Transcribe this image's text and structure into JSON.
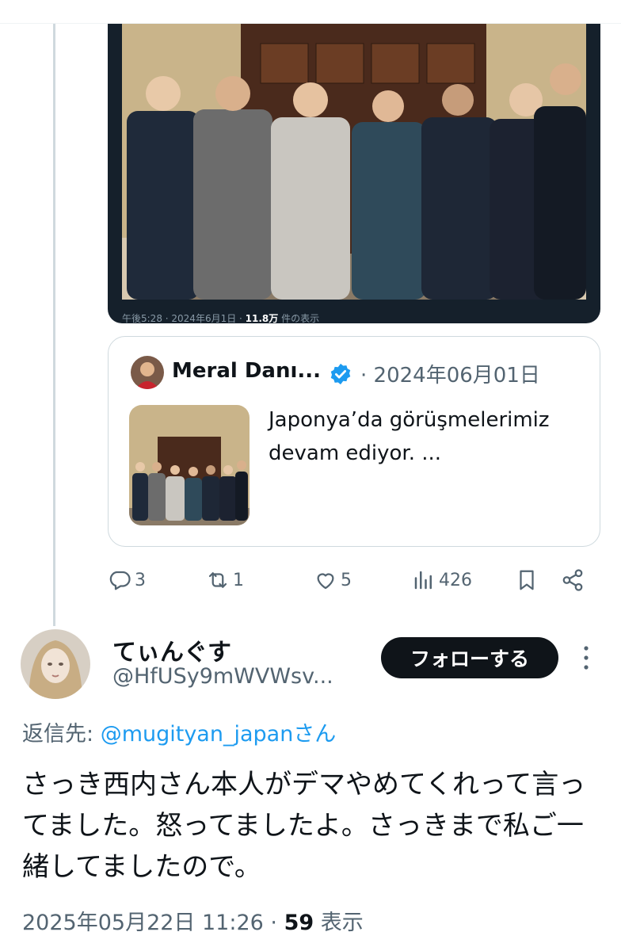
{
  "photo_meta": {
    "time": "午後5:28",
    "sep1": " · ",
    "date": "2024年6月1日",
    "sep2": " · ",
    "views": "11.8万",
    "views_suffix": " 件の表示"
  },
  "quote": {
    "author_name": "Meral Danı...",
    "date": "· 2024年06月01日",
    "text": "Japonya’da görüşmelerimiz devam ediyor. ..."
  },
  "actions": {
    "replies": "3",
    "reposts": "1",
    "likes": "5",
    "views": "426"
  },
  "reply": {
    "author_name": "てぃんぐす",
    "author_handle": "@HfUSy9mWVWsv...",
    "follow_label": "フォローする",
    "reply_to_label": "返信先: ",
    "reply_to_mention": "@mugityan_japanさん",
    "text": "さっき西内さん本人がデマやめてくれって言ってました。怒ってましたよ。さっきまで私ご一緒してましたので。",
    "date": "2025年05月22日 11:26",
    "sep": " · ",
    "views": "59",
    "views_suffix": " 表示"
  },
  "colors": {
    "accent": "#1d9bf0",
    "text": "#0f1419",
    "muted": "#536471"
  }
}
